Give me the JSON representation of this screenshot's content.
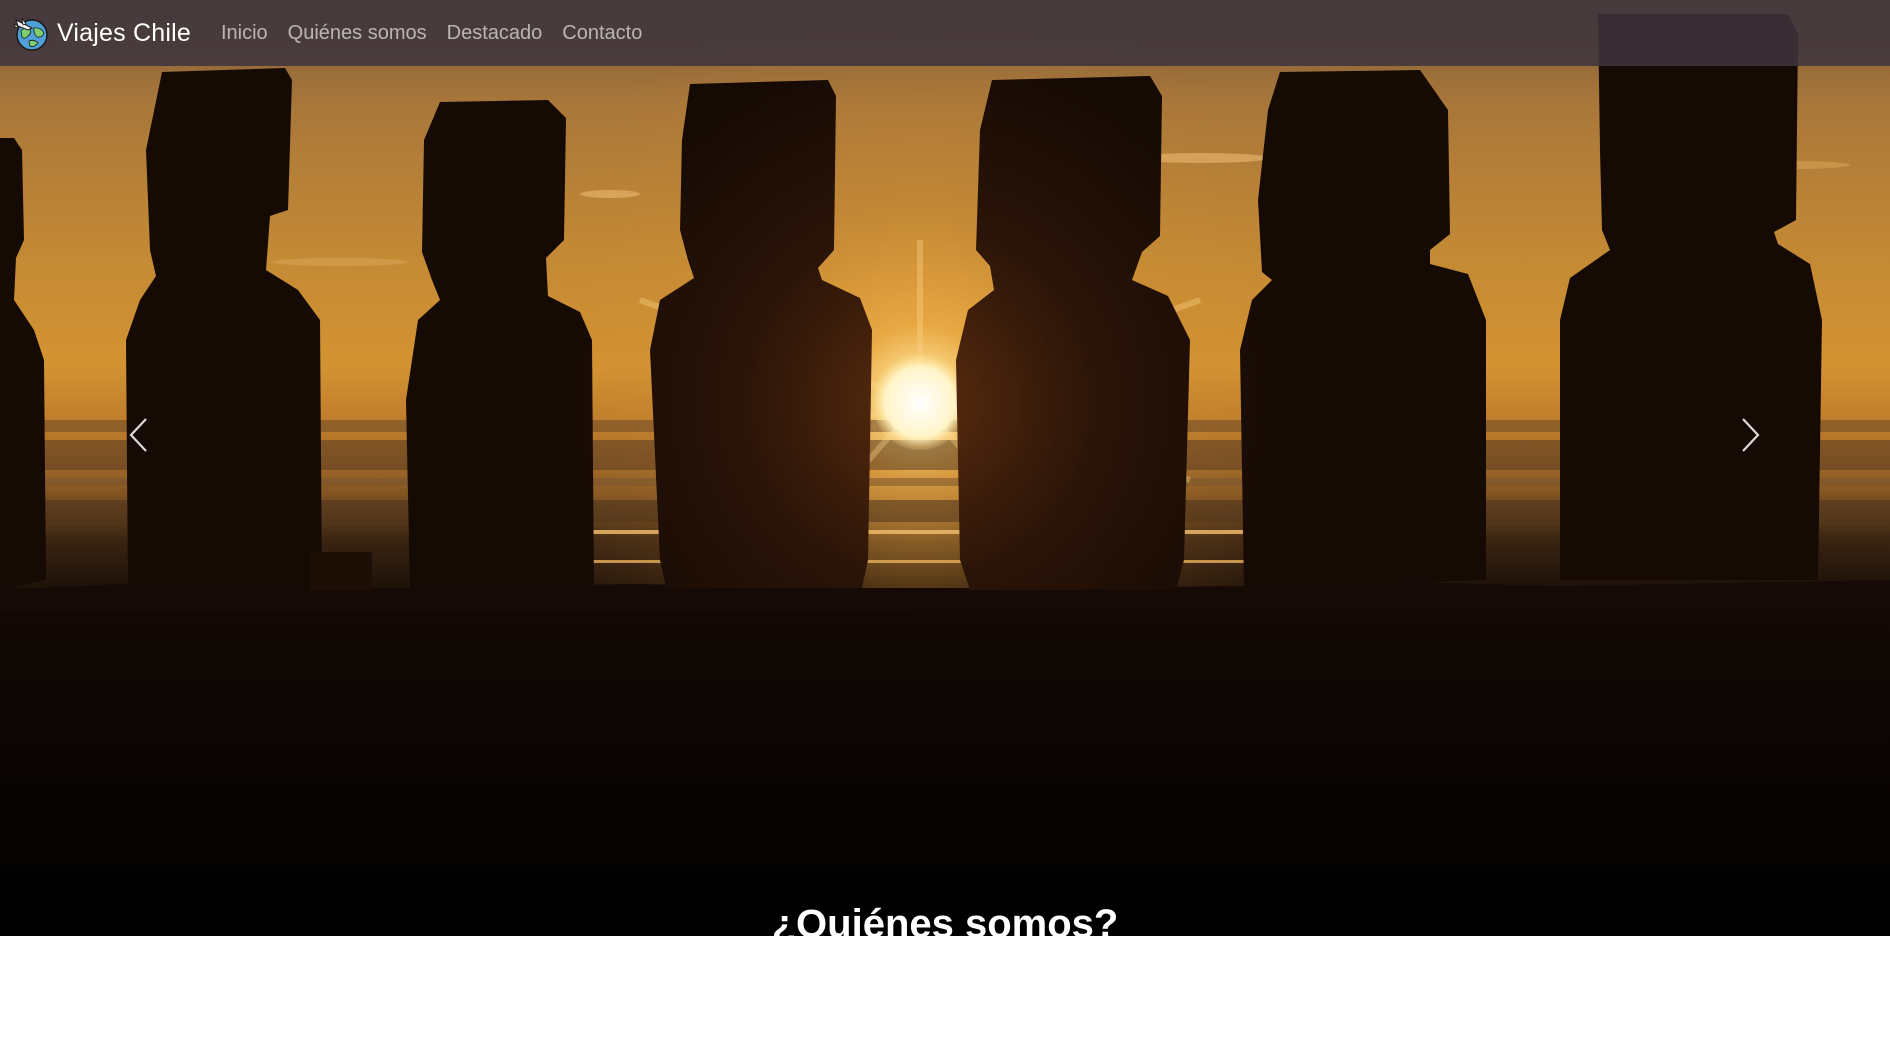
{
  "navbar": {
    "brand_name": "Viajes Chile",
    "brand_icon": "globe-airplane-logo",
    "links": [
      {
        "label": "Inicio"
      },
      {
        "label": "Quiénes somos"
      },
      {
        "label": "Destacado"
      },
      {
        "label": "Contacto"
      }
    ]
  },
  "hero": {
    "image": "moai-statues-sunset-silhouette",
    "prev_icon": "chevron-left-icon",
    "next_icon": "chevron-right-icon"
  },
  "about": {
    "title": "¿Quiénes somos?"
  },
  "colors": {
    "navbar_bg": "#3e343c",
    "sky_top": "#b07a3a",
    "sun": "#fff6d0",
    "silhouette": "#1a0d06",
    "section_bg": "#000000"
  }
}
